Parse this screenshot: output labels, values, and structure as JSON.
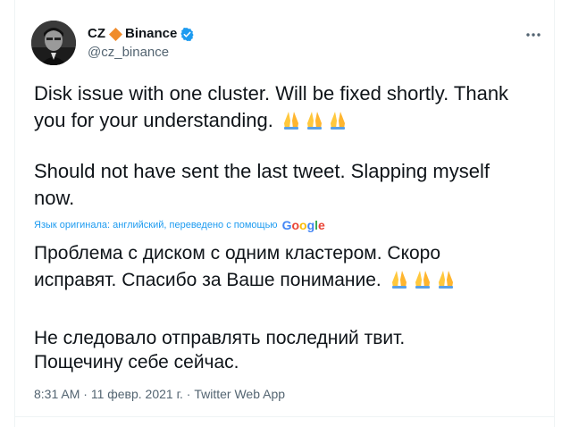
{
  "author": {
    "name": "CZ",
    "affiliation": "Binance",
    "handle": "@cz_binance",
    "diamond_icon": "orange-diamond-icon",
    "verified_icon": "verified-badge-icon",
    "accent_color": "#1d9bf0"
  },
  "menu": {
    "icon": "more-options-icon"
  },
  "tweet": {
    "line1": "Disk issue with one cluster. Will be fixed shortly. Thank",
    "line2": "you for your understanding.",
    "line3": "Should not have sent the last tweet. Slapping myself",
    "line4": "now.",
    "emoji": "folded-hands-icon"
  },
  "translation": {
    "note": "Язык оригинала: английский, переведено с помощью",
    "provider_G": "G",
    "provider_o1": "o",
    "provider_o2": "o",
    "provider_g": "g",
    "provider_l": "l",
    "provider_e": "e",
    "line1": "Проблема с диском с одним кластером. Скоро",
    "line2": "исправят. Спасибо за Ваше понимание.",
    "line3": " Не следовало отправлять последний твит.",
    "line4": "Пощечину себе сейчас."
  },
  "meta": {
    "time": "8:31 AM",
    "sep1": " · ",
    "date": "11 февр. 2021 г.",
    "sep2": " · ",
    "source": "Twitter Web App"
  }
}
